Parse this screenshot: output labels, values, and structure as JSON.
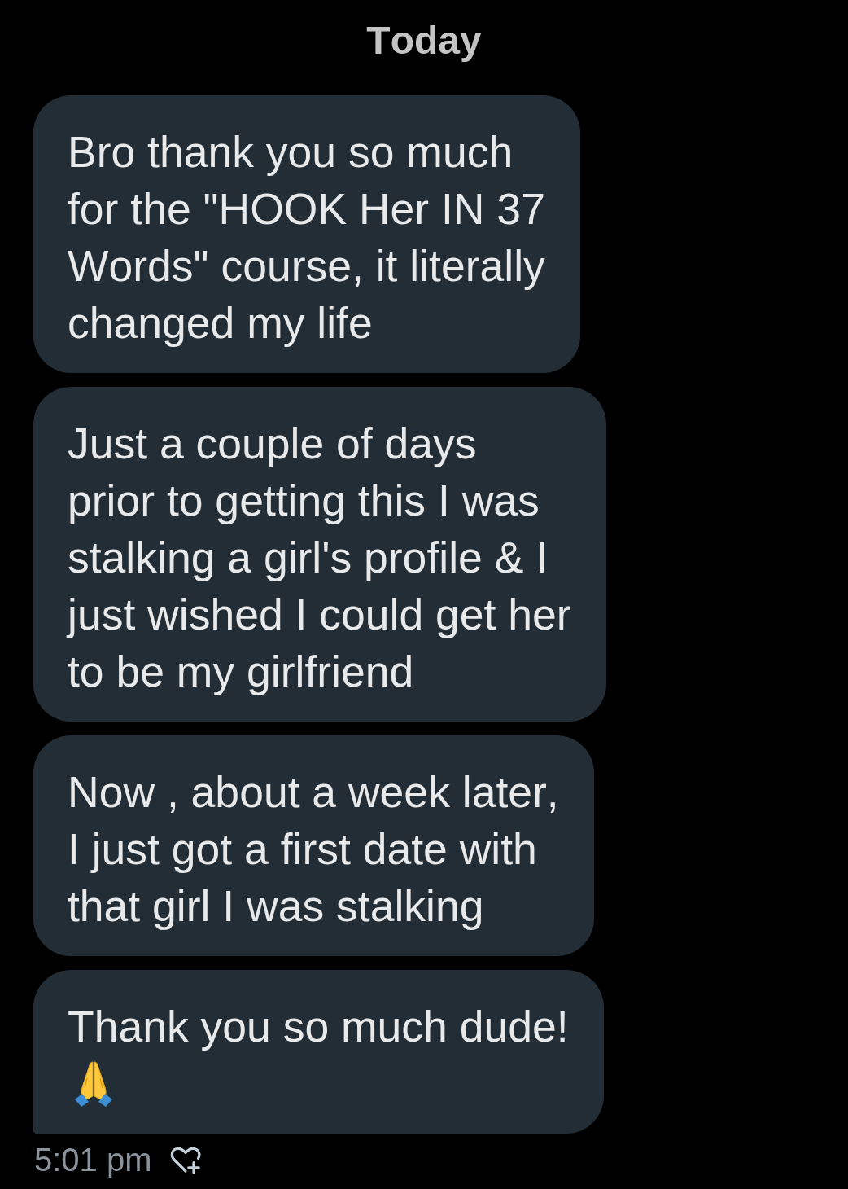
{
  "date_divider": "Today",
  "messages": [
    {
      "text": "Bro thank you so much for the \"HOOK Her IN 37 Words\" course, it literally changed my life",
      "trailing_emoji": false
    },
    {
      "text": "Just a couple of days prior to getting this I was stalking a girl's profile & I just wished I could get her to be my girlfriend",
      "trailing_emoji": false
    },
    {
      "text": "Now , about a week later, I just got a first date with that girl I was stalking",
      "trailing_emoji": false
    },
    {
      "text": "Thank you so much dude!",
      "trailing_emoji": true
    }
  ],
  "timestamp": "5:01 pm"
}
